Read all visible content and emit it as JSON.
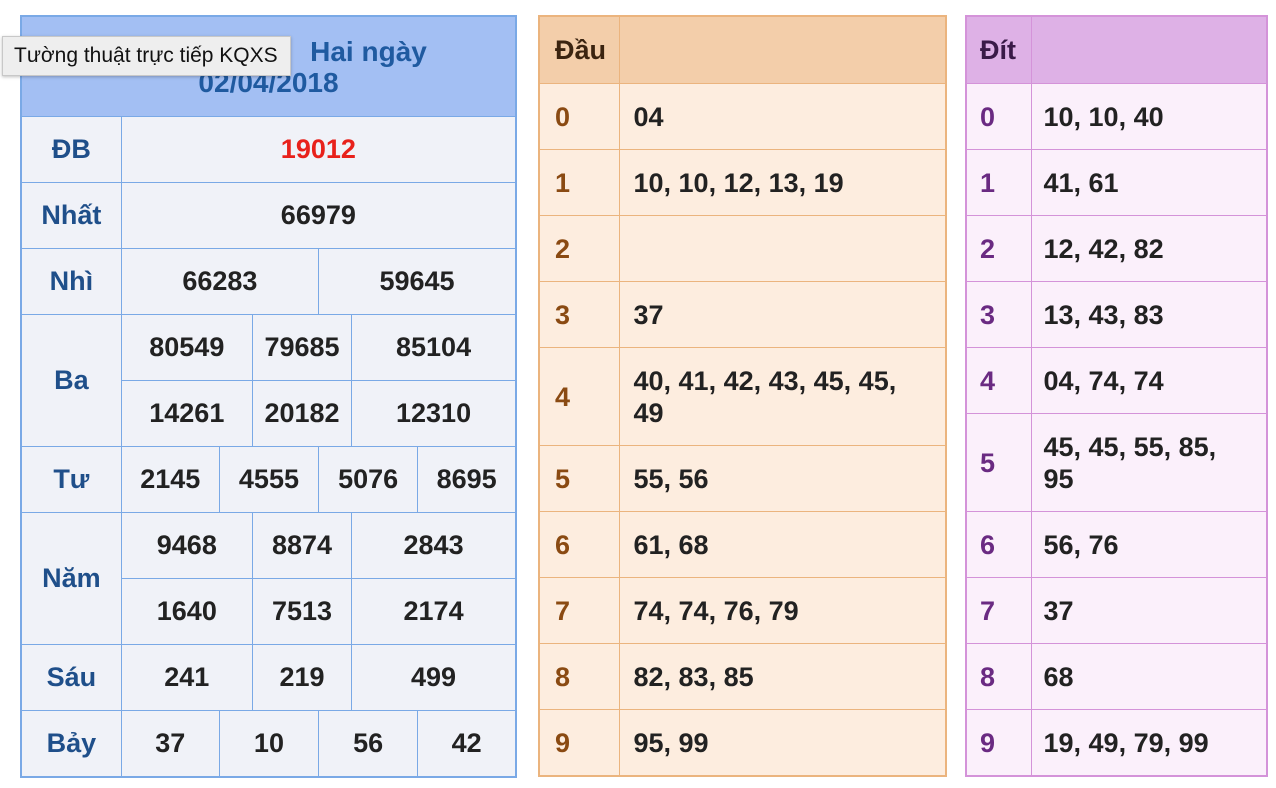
{
  "results": {
    "title_prefix": "Hai ngày",
    "title_date": "02/04/2018",
    "prizes": {
      "db": {
        "label": "ĐB",
        "values": [
          "19012"
        ]
      },
      "nhat": {
        "label": "Nhất",
        "values": [
          "66979"
        ]
      },
      "nhi": {
        "label": "Nhì",
        "values": [
          "66283",
          "59645"
        ]
      },
      "ba": {
        "label": "Ba",
        "values": [
          "80549",
          "79685",
          "85104",
          "14261",
          "20182",
          "12310"
        ]
      },
      "tu": {
        "label": "Tư",
        "values": [
          "2145",
          "4555",
          "5076",
          "8695"
        ]
      },
      "nam": {
        "label": "Năm",
        "values": [
          "9468",
          "8874",
          "2843",
          "1640",
          "7513",
          "2174"
        ]
      },
      "sau": {
        "label": "Sáu",
        "values": [
          "241",
          "219",
          "499"
        ]
      },
      "bay": {
        "label": "Bảy",
        "values": [
          "37",
          "10",
          "56",
          "42"
        ]
      }
    }
  },
  "dau": {
    "header": "Đầu",
    "rows": [
      {
        "key": "0",
        "values": "04"
      },
      {
        "key": "1",
        "values": "10, 10, 12, 13, 19"
      },
      {
        "key": "2",
        "values": ""
      },
      {
        "key": "3",
        "values": "37"
      },
      {
        "key": "4",
        "values": "40, 41, 42, 43, 45, 45, 49"
      },
      {
        "key": "5",
        "values": "55, 56"
      },
      {
        "key": "6",
        "values": "61, 68"
      },
      {
        "key": "7",
        "values": "74, 74, 76, 79"
      },
      {
        "key": "8",
        "values": "82, 83, 85"
      },
      {
        "key": "9",
        "values": "95, 99"
      }
    ]
  },
  "dit": {
    "header": "Đít",
    "rows": [
      {
        "key": "0",
        "values": "10, 10, 40"
      },
      {
        "key": "1",
        "values": "41, 61"
      },
      {
        "key": "2",
        "values": "12, 42, 82"
      },
      {
        "key": "3",
        "values": "13, 43, 83"
      },
      {
        "key": "4",
        "values": "04, 74, 74"
      },
      {
        "key": "5",
        "values": "45, 45, 55, 85, 95"
      },
      {
        "key": "6",
        "values": "56, 76"
      },
      {
        "key": "7",
        "values": "37"
      },
      {
        "key": "8",
        "values": "68"
      },
      {
        "key": "9",
        "values": "19, 49, 79, 99"
      }
    ]
  },
  "tooltip": {
    "text": "Tường thuật trực tiếp KQXS"
  },
  "colors": {
    "results_border": "#7aa9e6",
    "results_header": "#a3bff3",
    "db_value": "#e8211b",
    "dau_border": "#ebb47e",
    "dit_border": "#d493d9"
  }
}
